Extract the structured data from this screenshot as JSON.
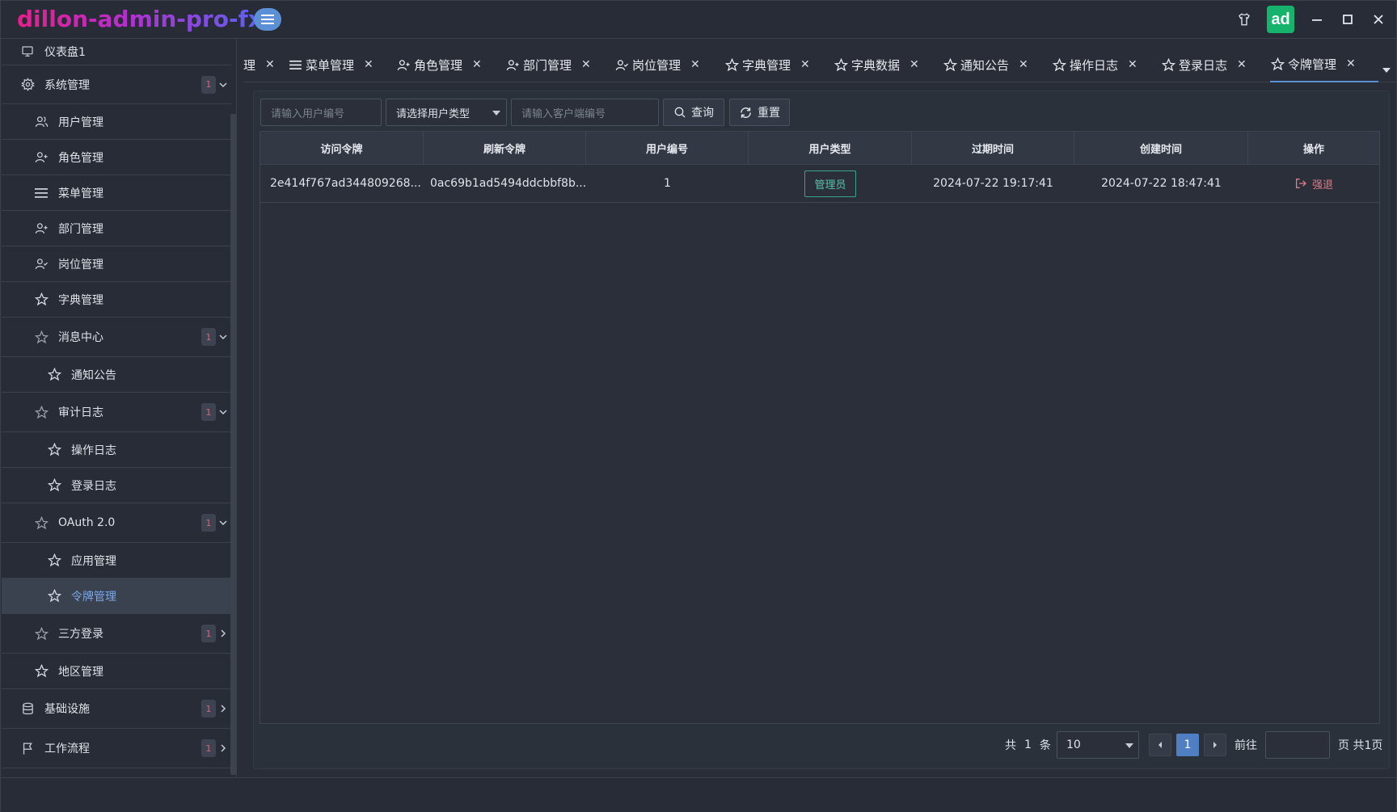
{
  "app": {
    "title": "dillon-admin-pro-fx",
    "avatar_text": "ad"
  },
  "sidebar": {
    "items": [
      {
        "label": "仪表盘1",
        "icon": "monitor-icon"
      },
      {
        "label": "系统管理",
        "icon": "gear-icon",
        "badge": "1"
      },
      {
        "label": "用户管理",
        "icon": "users-icon"
      },
      {
        "label": "角色管理",
        "icon": "user-plus-icon"
      },
      {
        "label": "菜单管理",
        "icon": "menu-icon"
      },
      {
        "label": "部门管理",
        "icon": "user-plus-icon"
      },
      {
        "label": "岗位管理",
        "icon": "user-check-icon"
      },
      {
        "label": "字典管理",
        "icon": "star-icon"
      },
      {
        "label": "消息中心",
        "icon": "star-outline-icon",
        "badge": "1"
      },
      {
        "label": "通知公告",
        "icon": "star-icon"
      },
      {
        "label": "审计日志",
        "icon": "star-outline-icon",
        "badge": "1"
      },
      {
        "label": "操作日志",
        "icon": "star-icon"
      },
      {
        "label": "登录日志",
        "icon": "star-icon"
      },
      {
        "label": "OAuth 2.0",
        "icon": "star-outline-icon",
        "badge": "1"
      },
      {
        "label": "应用管理",
        "icon": "star-icon"
      },
      {
        "label": "令牌管理",
        "icon": "star-icon"
      },
      {
        "label": "三方登录",
        "icon": "star-outline-icon",
        "badge": "1"
      },
      {
        "label": "地区管理",
        "icon": "star-icon"
      },
      {
        "label": "基础设施",
        "icon": "database-icon",
        "badge": "1"
      },
      {
        "label": "工作流程",
        "icon": "flag-icon",
        "badge": "1"
      }
    ]
  },
  "tabs": [
    {
      "label": "理"
    },
    {
      "label": "菜单管理",
      "icon": "menu-icon"
    },
    {
      "label": "角色管理",
      "icon": "user-plus-icon"
    },
    {
      "label": "部门管理",
      "icon": "user-plus-icon"
    },
    {
      "label": "岗位管理",
      "icon": "user-check-icon"
    },
    {
      "label": "字典管理",
      "icon": "star-icon"
    },
    {
      "label": "字典数据",
      "icon": "star-icon"
    },
    {
      "label": "通知公告",
      "icon": "star-icon"
    },
    {
      "label": "操作日志",
      "icon": "star-icon"
    },
    {
      "label": "登录日志",
      "icon": "star-icon"
    },
    {
      "label": "令牌管理",
      "icon": "star-icon"
    }
  ],
  "filters": {
    "user_id_placeholder": "请输入用户编号",
    "user_type_placeholder": "请选择用户类型",
    "client_id_placeholder": "请输入客户端编号",
    "search_label": "查询",
    "reset_label": "重置"
  },
  "table": {
    "columns": [
      "访问令牌",
      "刷新令牌",
      "用户编号",
      "用户类型",
      "过期时间",
      "创建时间",
      "操作"
    ],
    "rows": [
      {
        "access_token": "2e414f767ad344809268...",
        "refresh_token": "0ac69b1ad5494ddcbbf8b...",
        "user_id": "1",
        "user_type": "管理员",
        "expire_time": "2024-07-22 19:17:41",
        "create_time": "2024-07-22 18:47:41",
        "action": "强退"
      }
    ]
  },
  "pagination": {
    "total_prefix": "共",
    "total": "1",
    "total_suffix": "条",
    "page_size": "10",
    "current_page": "1",
    "goto_label": "前往",
    "pages_suffix": "页 共1页"
  },
  "colors": {
    "accent": "#5b8fd6",
    "success": "#15b36b",
    "danger": "#e07a85",
    "tag": "#59c2ad"
  }
}
